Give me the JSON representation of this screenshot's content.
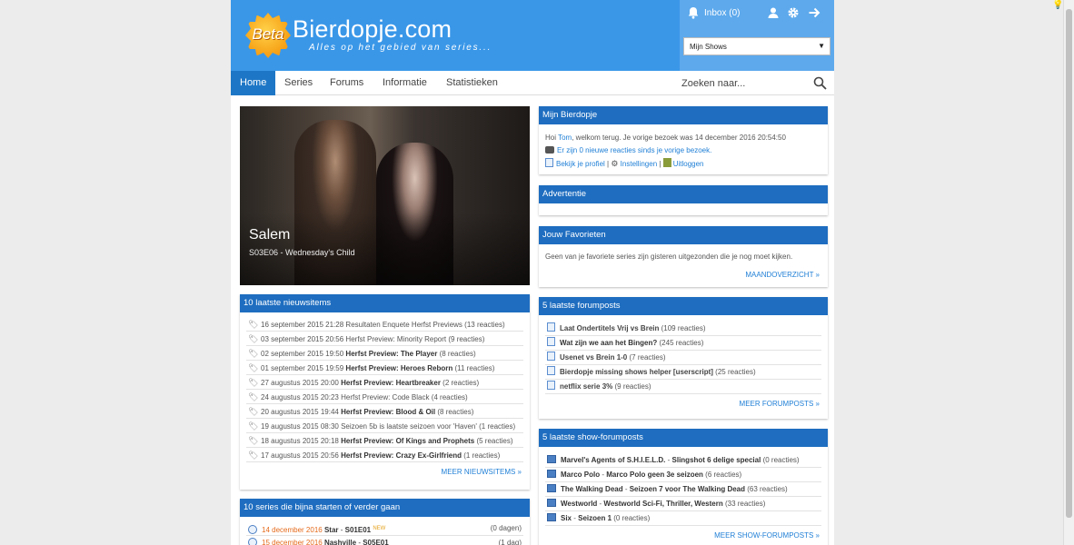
{
  "logo": {
    "badge": "Beta",
    "title": "Bierdopje.com",
    "subtitle": "Alles op het gebied van series..."
  },
  "userbox": {
    "inbox": "Inbox (0)",
    "shows_select": "Mijn Shows"
  },
  "nav": {
    "items": [
      "Home",
      "Series",
      "Forums",
      "Informatie",
      "Statistieken"
    ],
    "active": "Home",
    "search_placeholder": "Zoeken naar..."
  },
  "hero": {
    "title": "Salem",
    "subtitle": "S03E06 - Wednesday's Child"
  },
  "news": {
    "title": "10 laatste nieuwsitems",
    "items": [
      {
        "date": "16 september 2015 21:28",
        "title": "Resultaten Enquete Herfst Previews",
        "reactions": "(13 reacties)",
        "bold": false
      },
      {
        "date": "03 september 2015 20:56",
        "title": "Herfst Preview: Minority Report",
        "reactions": "(9 reacties)",
        "bold": false
      },
      {
        "date": "02 september 2015 19:50",
        "title": "Herfst Preview: The Player",
        "reactions": "(8 reacties)",
        "bold": true
      },
      {
        "date": "01 september 2015 19:59",
        "title": "Herfst Preview: Heroes Reborn",
        "reactions": "(11 reacties)",
        "bold": true
      },
      {
        "date": "27 augustus 2015 20:00",
        "title": "Herfst Preview: Heartbreaker",
        "reactions": "(2 reacties)",
        "bold": true
      },
      {
        "date": "24 augustus 2015 20:23",
        "title": "Herfst Preview: Code Black",
        "reactions": "(4 reacties)",
        "bold": false
      },
      {
        "date": "20 augustus 2015 19:44",
        "title": "Herfst Preview: Blood & Oil",
        "reactions": "(8 reacties)",
        "bold": true
      },
      {
        "date": "19 augustus 2015 08:30",
        "title": "Seizoen 5b is laatste seizoen voor 'Haven'",
        "reactions": "(1 reacties)",
        "bold": false
      },
      {
        "date": "18 augustus 2015 20:18",
        "title": "Herfst Preview: Of Kings and Prophets",
        "reactions": "(5 reacties)",
        "bold": true
      },
      {
        "date": "17 augustus 2015 20:56",
        "title": "Herfst Preview: Crazy Ex-Girlfriend",
        "reactions": "(1 reacties)",
        "bold": true
      }
    ],
    "more": "MEER NIEUWSITEMS »"
  },
  "starting": {
    "title": "10 series die bijna starten of verder gaan",
    "items": [
      {
        "date": "14 december 2016",
        "show": "Star",
        "episode": "S01E01",
        "badge": "NEW",
        "days": "(0 dagen)"
      },
      {
        "date": "15 december 2016",
        "show": "Nashville",
        "episode": "S05E01",
        "badge": "",
        "days": "(1 dag)"
      }
    ]
  },
  "mijn": {
    "title": "Mijn Bierdopje",
    "greeting_prefix": "Hoi",
    "user": "Tom",
    "greeting_suffix": ", welkom terug. Je vorige bezoek was 14 december 2016 20:54:50",
    "new_reactions": "Er zijn 0 nieuwe reacties sinds je vorige bezoek.",
    "profile": "Bekijk je profiel",
    "settings": "Instellingen",
    "logout": "Uitloggen",
    "sep": "|"
  },
  "advert": {
    "title": "Advertentie"
  },
  "favs": {
    "title": "Jouw Favorieten",
    "text": "Geen van je favoriete series zijn gisteren uitgezonden die je nog moet kijken.",
    "more": "MAANDOVERZICHT »"
  },
  "forum": {
    "title": "5 laatste forumposts",
    "items": [
      {
        "title": "Laat Ondertitels Vrij vs Brein",
        "reactions": "(109 reacties)",
        "bold": false
      },
      {
        "title": "Wat zijn we aan het Bingen?",
        "reactions": "(245 reacties)",
        "bold": true
      },
      {
        "title": "Usenet vs Brein 1-0",
        "reactions": "(7 reacties)",
        "bold": false
      },
      {
        "title": "Bierdopje missing shows helper [userscript]",
        "reactions": "(25 reacties)",
        "bold": false
      },
      {
        "title": "netflix serie 3%",
        "reactions": "(9 reacties)",
        "bold": false
      }
    ],
    "more": "MEER FORUMPOSTS »"
  },
  "showforum": {
    "title": "5 laatste show-forumposts",
    "items": [
      {
        "show": "Marvel's Agents of S.H.I.E.L.D.",
        "topic": "Slingshot 6 delige special",
        "reactions": "(0 reacties)"
      },
      {
        "show": "Marco Polo",
        "topic": "Marco Polo geen 3e seizoen",
        "reactions": "(6 reacties)"
      },
      {
        "show": "The Walking Dead",
        "topic": "Seizoen 7 voor The Walking Dead",
        "reactions": "(63 reacties)"
      },
      {
        "show": "Westworld",
        "topic": "Westworld Sci-Fi, Thriller, Western",
        "reactions": "(33 reacties)"
      },
      {
        "show": "Six",
        "topic": "Seizoen 1",
        "reactions": "(0 reacties)"
      }
    ],
    "more": "MEER SHOW-FORUMPOSTS »",
    "sep": " - "
  }
}
